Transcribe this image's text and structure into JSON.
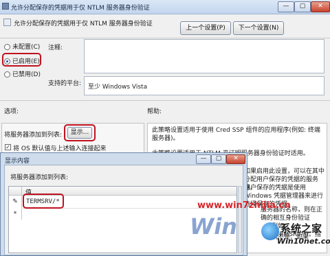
{
  "window": {
    "title": "允许分配保存的凭据用于仅 NTLM 服务器身份验证",
    "minimize_label": "—",
    "maximize_label": "▢",
    "close_label": "✕"
  },
  "header": {
    "policy_name": "允许分配保存的凭据用于仅 NTLM 服务器身份验证",
    "prev_button": "上一个设置(P)",
    "next_button": "下一个设置(N)"
  },
  "state_options": [
    {
      "label": "未配置(C)",
      "selected": false
    },
    {
      "label": "已启用(E)",
      "selected": true
    },
    {
      "label": "已禁用(D)",
      "selected": false
    }
  ],
  "comment": {
    "label": "注释:",
    "value": ""
  },
  "platform": {
    "label": "支持的平台:",
    "value": "至少 Windows Vista"
  },
  "sections": {
    "options_label": "选项:",
    "help_label": "帮助:"
  },
  "options": {
    "add_servers_label": "将服务器添加到列表:",
    "show_button": "显示...",
    "concat_checkbox_label": "将 OS 默认值与上述输入连接起来",
    "concat_checked": true
  },
  "help_lines": [
    "此策略设置适用于使用 Cred SSP 组件的应用程序(例如: 终端服务器)。",
    "此策略设置适用于 NTLM 来证明服务器身份验证时适用。",
    "如果启用此设置，可以在其中分配用户保存的凭据的服务器。",
    "用户保存的凭据是使用 Windows 凭据管理器来进行选择保存的凭据。",
    "服务器的名称，则在正确的相互身份验证",
    "例如 TERMSRV/*)。指",
    "机不是、如果"
  ],
  "dialog": {
    "title": "显示内容",
    "minimize_label": "—",
    "maximize_label": "▢",
    "close_label": "✕",
    "list_label": "将服务器添加到列表:",
    "column_header": "值",
    "rows": [
      {
        "marker": "✎",
        "value": "TERMSRV/*"
      },
      {
        "marker": "*",
        "value": ""
      }
    ]
  },
  "watermarks": {
    "site_url": "www.win7zhijia.cn",
    "brand_cn": "系统之家",
    "brand_url": "Win10net.com",
    "logo_text": "Win"
  },
  "colors": {
    "highlight_ring": "#c0101e",
    "watermark_red": "#d6262b",
    "titlebar": "#c2d5ee"
  }
}
